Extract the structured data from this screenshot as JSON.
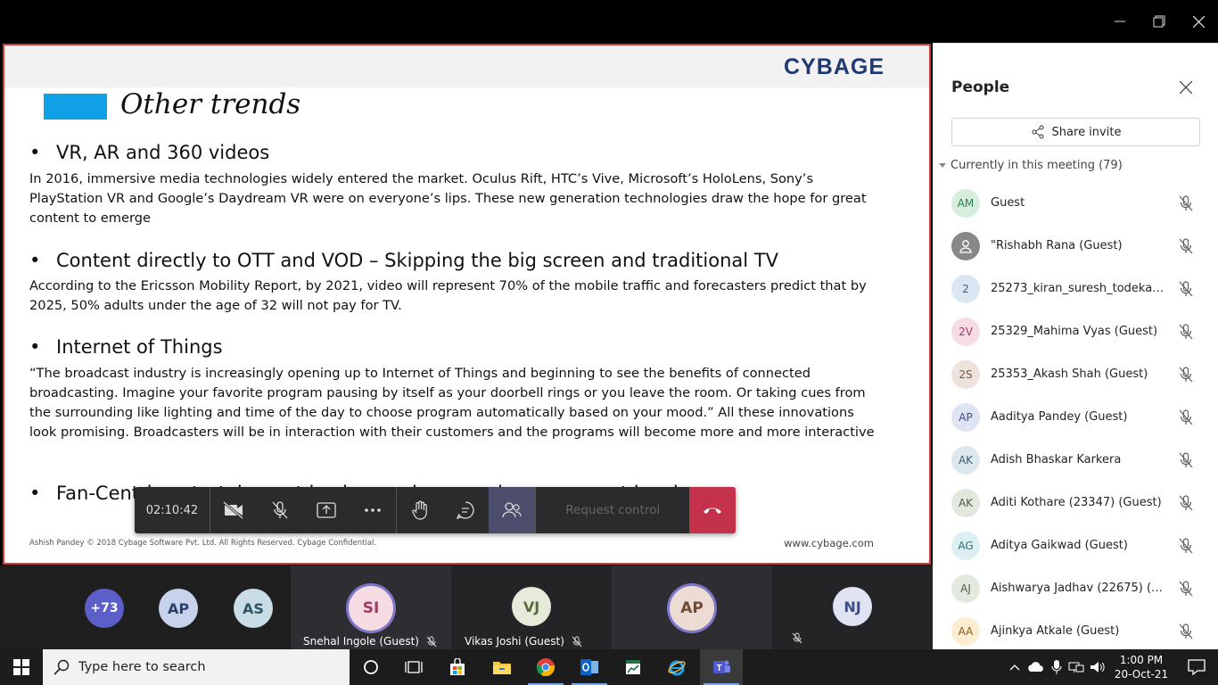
{
  "slide": {
    "logo": "CYBAGE",
    "title": "Other trends",
    "bullets": [
      {
        "heading": "VR, AR and 360 videos",
        "text": "In 2016, immersive media technologies widely entered the market. Oculus Rift, HTC’s Vive, Microsoft’s HoloLens, Sony’s PlayStation VR and Google’s Daydream VR were on everyone’s lips. These new generation technologies draw the hope for great content to emerge"
      },
      {
        "heading": "Content directly to OTT and VOD – Skipping the big screen and traditional TV",
        "text": "According to the Ericsson Mobility Report, by 2021, video will represent 70% of the mobile traffic and forecasters predict that by 2025, 50% adults under the age of 32 will not pay for TV."
      },
      {
        "heading": "Internet of Things",
        "text": "“The broadcast industry is increasingly opening up to Internet of Things and beginning to see the benefits of connected broadcasting. Imagine your favorite program pausing by itself as your doorbell rings or you leave the room. Or taking cues from the surrounding like lighting and time of the day to choose program automatically based on your mood.” All these innovations look promising. Broadcasters will be in interaction with their customers and the programs will become more and more interactive"
      },
      {
        "heading": "Fan-Centric entertainment business – increased engagement level",
        "text": ""
      }
    ],
    "footer_presenter": "Ashish Pandey",
    "footer_copyright": "© 2018 Cybage Software Pvt. Ltd. All Rights Reserved. Cybage Confidential.",
    "footer_url": "www.cybage.com"
  },
  "call_bar": {
    "timer": "02:10:42",
    "request_control": "Request control"
  },
  "gallery": {
    "overflow": "+73",
    "tiles": [
      {
        "initials": "AP",
        "name": ""
      },
      {
        "initials": "AS",
        "name": ""
      },
      {
        "initials": "SI",
        "name": "Snehal Ingole (Guest)"
      },
      {
        "initials": "VJ",
        "name": "Vikas Joshi (Guest)"
      },
      {
        "initials": "AP",
        "name": ""
      },
      {
        "initials": "NJ",
        "name": ""
      }
    ]
  },
  "people": {
    "title": "People",
    "share_invite": "Share invite",
    "group_label": "Currently in this meeting (79)",
    "participants": [
      {
        "initials": "AM",
        "name": "Guest",
        "bg": "#d6eedb",
        "fg": "#2e7d4f"
      },
      {
        "initials": "",
        "name": "\"Rishabh Rana (Guest)",
        "bg": "#8a8886",
        "fg": "#ffffff"
      },
      {
        "initials": "2",
        "name": "25273_kiran_suresh_todekar ...",
        "bg": "#dbe6f3",
        "fg": "#3b5b85"
      },
      {
        "initials": "2V",
        "name": "25329_Mahima Vyas (Guest)",
        "bg": "#f6dce6",
        "fg": "#a33a63"
      },
      {
        "initials": "2S",
        "name": "25353_Akash Shah (Guest)",
        "bg": "#eee3dc",
        "fg": "#7a5541"
      },
      {
        "initials": "AP",
        "name": "Aaditya Pandey (Guest)",
        "bg": "#dfe4f5",
        "fg": "#3c4d8a"
      },
      {
        "initials": "AK",
        "name": "Adish Bhaskar Karkera",
        "bg": "#dde8ee",
        "fg": "#3f5c6b"
      },
      {
        "initials": "AK",
        "name": "Aditi Kothare (23347) (Guest)",
        "bg": "#e2e8dd",
        "fg": "#4f6140"
      },
      {
        "initials": "AG",
        "name": "Aditya Gaikwad (Guest)",
        "bg": "#dcf0f3",
        "fg": "#2d6f7a"
      },
      {
        "initials": "AJ",
        "name": "Aishwarya Jadhav (22675) (G...",
        "bg": "#e4e9e0",
        "fg": "#4c5e43"
      },
      {
        "initials": "AA",
        "name": "Ajinkya Atkale (Guest)",
        "bg": "#fbecd2",
        "fg": "#8a5b12"
      }
    ]
  },
  "taskbar": {
    "search_placeholder": "Type here to search",
    "time": "1:00 PM",
    "date": "20-Oct-21"
  }
}
